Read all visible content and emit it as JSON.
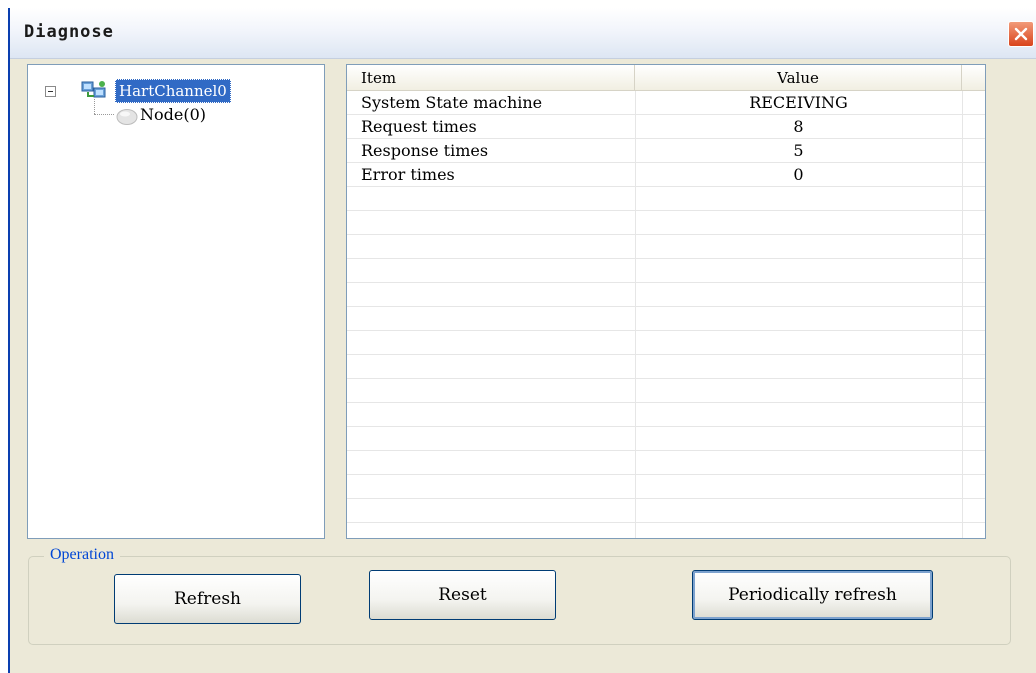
{
  "window": {
    "title": "Diagnose"
  },
  "icons": {
    "close": "close-icon",
    "channel": "network-icon",
    "node": "node-icon",
    "toggle": "collapse-icon"
  },
  "colors": {
    "selection": "#316ac5",
    "accent": "#0046d5",
    "close": "#d9441c"
  },
  "tree": {
    "channel_label": "HartChannel0",
    "node_label": "Node(0)"
  },
  "grid": {
    "headers": {
      "item": "Item",
      "value": "Value"
    },
    "rows": [
      {
        "item": "System State machine",
        "value": "RECEIVING"
      },
      {
        "item": "Request times",
        "value": "8"
      },
      {
        "item": "Response times",
        "value": "5"
      },
      {
        "item": "Error times",
        "value": "0"
      }
    ]
  },
  "operation": {
    "legend": "Operation",
    "refresh_label": "Refresh",
    "reset_label": "Reset",
    "periodic_label": "Periodically refresh"
  }
}
